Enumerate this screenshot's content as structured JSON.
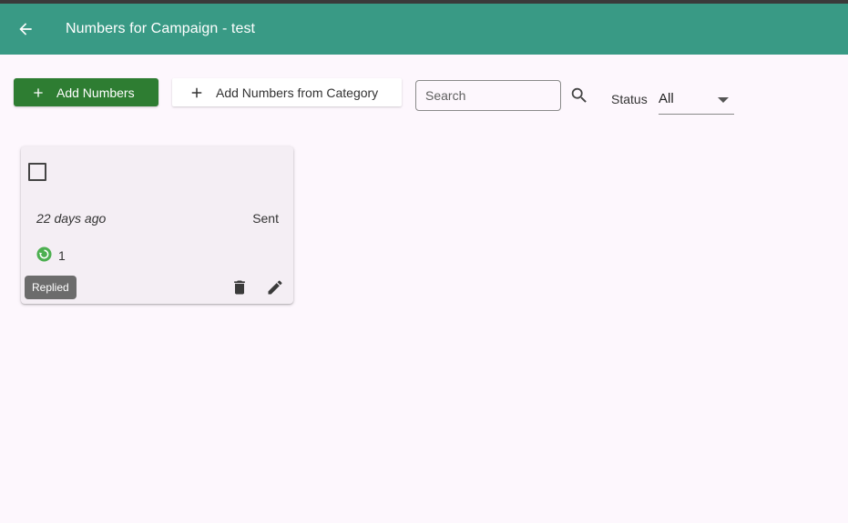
{
  "header": {
    "title": "Numbers for Campaign - test",
    "back_icon": "arrow-left-icon",
    "color": "#399a85"
  },
  "toolbar": {
    "add_numbers_label": "Add Numbers",
    "add_from_category_label": "Add Numbers from Category",
    "search_placeholder": "Search",
    "search_value": "",
    "status_label": "Status",
    "status_value": "All",
    "primary_color": "#2e7d32"
  },
  "cards": [
    {
      "checked": false,
      "time": "22 days ago",
      "status": "Sent",
      "replies_icon": "replied-icon",
      "replies_count": "1",
      "tooltip": "Replied"
    }
  ]
}
